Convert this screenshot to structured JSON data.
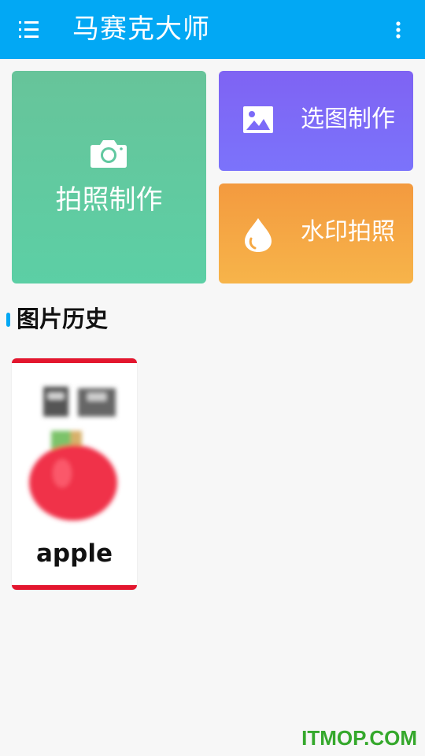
{
  "app": {
    "title": "马赛克大师",
    "accent": "#02a8f4"
  },
  "actions": [
    {
      "label": "拍照制作",
      "icon": "camera-icon",
      "color": "#5fc99e"
    },
    {
      "label": "选图制作",
      "icon": "image-icon",
      "color": "#7b6af8"
    },
    {
      "label": "水印拍照",
      "icon": "water-drop-icon",
      "color": "#f5a844"
    }
  ],
  "history": {
    "title": "图片历史",
    "items": [
      {
        "word": "apple",
        "border_color": "#e3162e"
      }
    ]
  },
  "watermark": {
    "text": "ITMOP.COM",
    "color": "#35a82c"
  }
}
